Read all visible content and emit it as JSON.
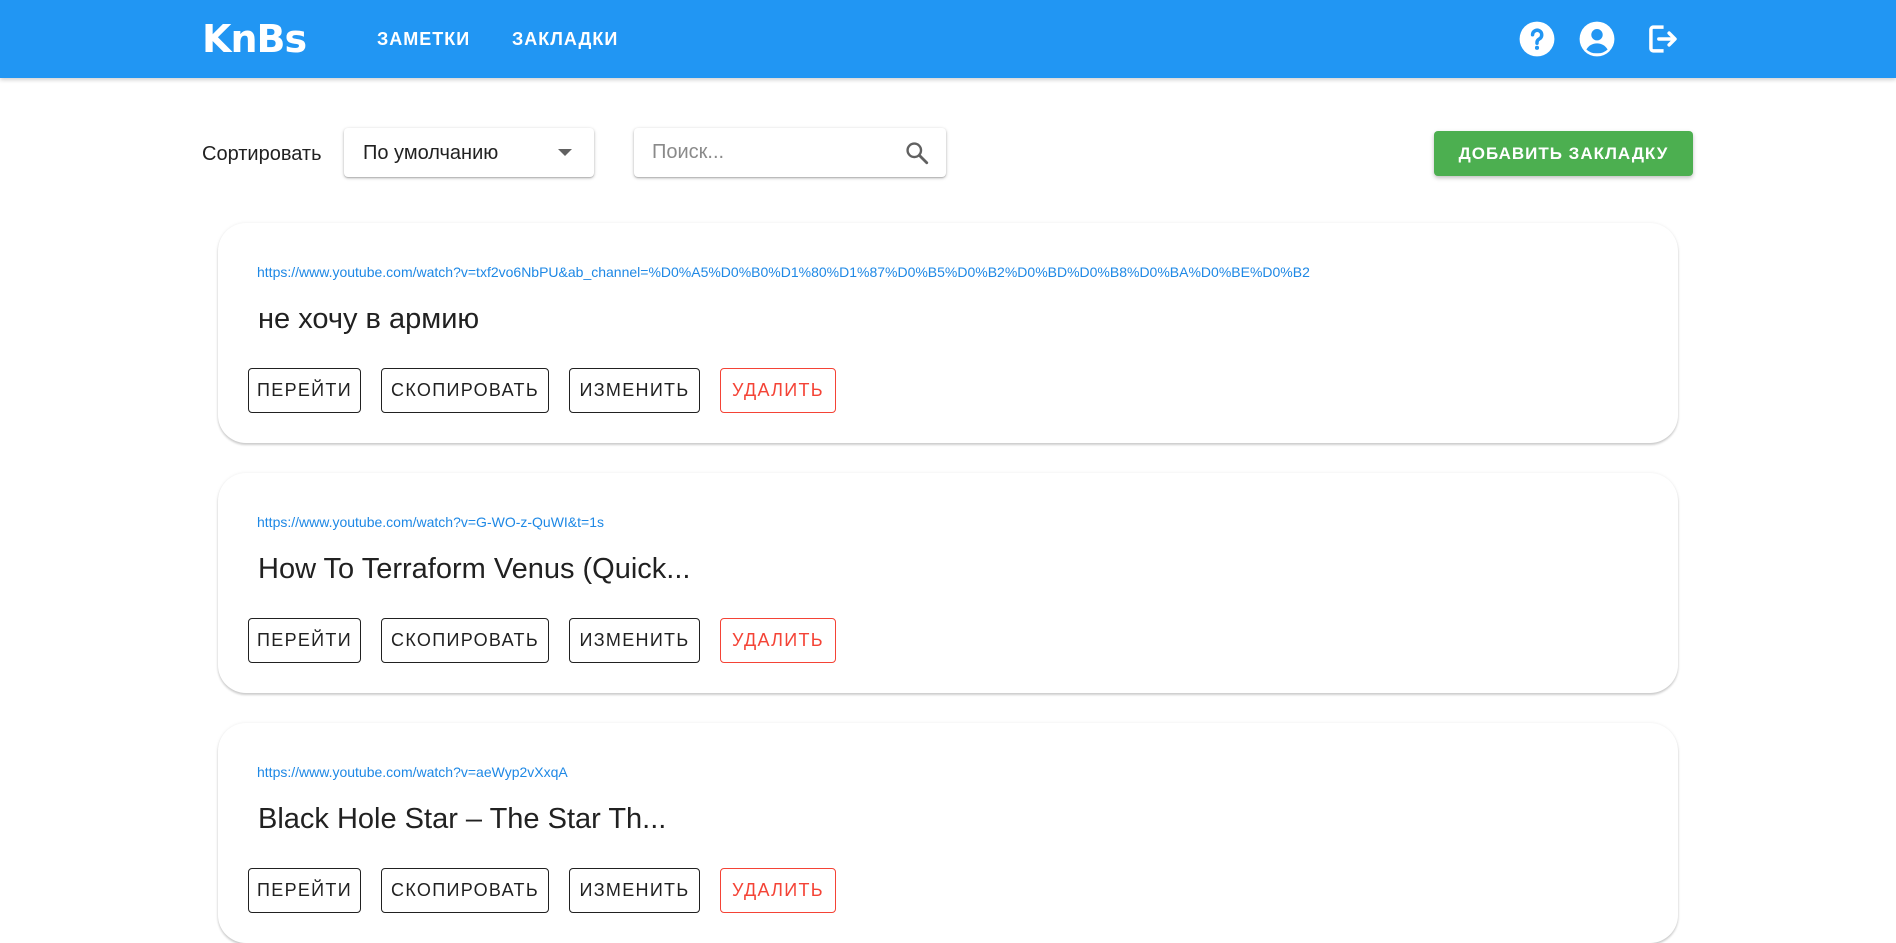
{
  "header": {
    "logo": "KnBs",
    "nav": [
      "ЗАМЕТКИ",
      "ЗАКЛАДКИ"
    ],
    "icons": [
      "help-icon",
      "account-icon",
      "logout-icon"
    ],
    "color": "#2196f3"
  },
  "toolbar": {
    "sort_label": "Сортировать",
    "sort_value": "По умолчанию",
    "search_placeholder": "Поиск...",
    "search_value": "",
    "add_button": "ДОБАВИТЬ ЗАКЛАДКУ",
    "add_color": "#4caf50"
  },
  "bookmarks": [
    {
      "url": "https://www.youtube.com/watch?v=txf2vo6NbPU&ab_channel=%D0%A5%D0%B0%D1%80%D1%87%D0%B5%D0%B2%D0%BD%D0%B8%D0%BA%D0%BE%D0%B2",
      "title": "не хочу в армию"
    },
    {
      "url": "https://www.youtube.com/watch?v=G-WO-z-QuWI&t=1s",
      "title": "How To Terraform Venus (Quick..."
    },
    {
      "url": "https://www.youtube.com/watch?v=aeWyp2vXxqA",
      "title": "Black Hole Star – The Star Th..."
    }
  ],
  "card_buttons": {
    "go": "ПЕРЕЙТИ",
    "copy": "СКОПИРОВАТЬ",
    "edit": "ИЗМЕНИТЬ",
    "delete": "УДАЛИТЬ",
    "delete_color": "#f44336"
  }
}
